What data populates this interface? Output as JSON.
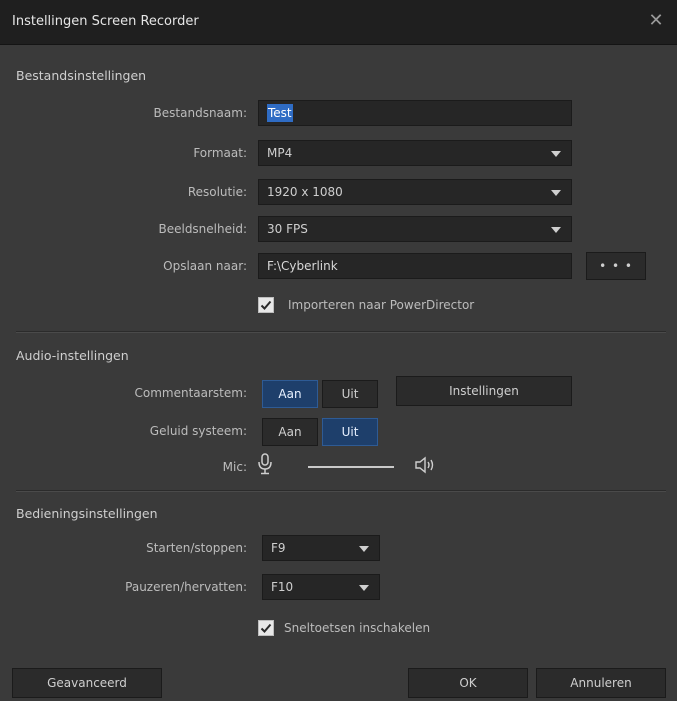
{
  "window": {
    "title": "Instellingen Screen Recorder",
    "close_icon": "close-icon"
  },
  "file_settings": {
    "section_title": "Bestandsinstellingen",
    "filename_label": "Bestandsnaam:",
    "filename_value": "Test",
    "format_label": "Formaat:",
    "format_value": "MP4",
    "resolution_label": "Resolutie:",
    "resolution_value": "1920 x 1080",
    "framerate_label": "Beeldsnelheid:",
    "framerate_value": "30 FPS",
    "save_to_label": "Opslaan naar:",
    "save_to_value": "F:\\Cyberlink",
    "browse_label": "• • •",
    "import_checkbox_label": "Importeren naar PowerDirector",
    "import_checked": true
  },
  "audio_settings": {
    "section_title": "Audio-instellingen",
    "commentary_label": "Commentaarstem:",
    "commentary_on": "Aan",
    "commentary_off": "Uit",
    "commentary_state": "Aan",
    "settings_button": "Instellingen",
    "system_sound_label": "Geluid systeem:",
    "system_on": "Aan",
    "system_off": "Uit",
    "system_state": "Uit",
    "mic_label": "Mic:",
    "mic_icon": "microphone-icon",
    "speaker_icon": "speaker-icon"
  },
  "control_settings": {
    "section_title": "Bedieningsinstellingen",
    "start_stop_label": "Starten/stoppen:",
    "start_stop_value": "F9",
    "pause_resume_label": "Pauzeren/hervatten:",
    "pause_resume_value": "F10",
    "hotkeys_checkbox_label": "Sneltoetsen inschakelen",
    "hotkeys_checked": true
  },
  "footer": {
    "advanced_button": "Geavanceerd",
    "ok_button": "OK",
    "cancel_button": "Annuleren"
  },
  "colors": {
    "background": "#3a3a3a",
    "titlebar": "#1f1f1f",
    "accent_active": "#1e3f6b",
    "selection": "#2f6cc4"
  }
}
